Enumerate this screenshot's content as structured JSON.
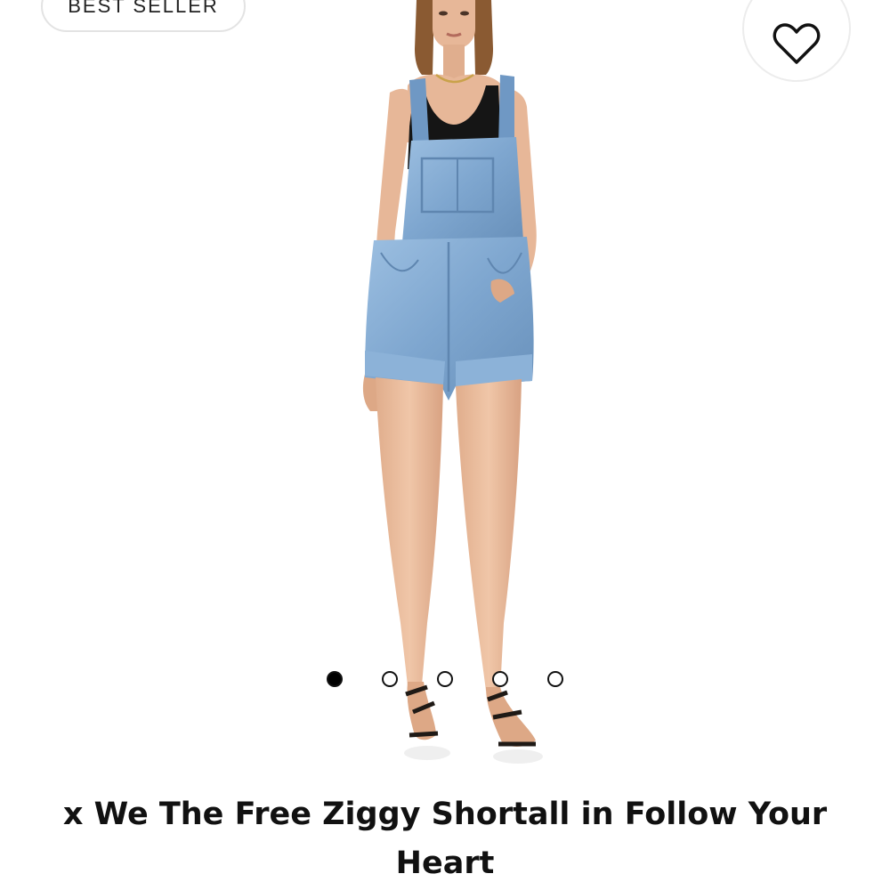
{
  "badge": {
    "label": "BEST SELLER"
  },
  "favorite": {
    "icon": "heart-outline-icon"
  },
  "gallery": {
    "slides": [
      "slide-1",
      "slide-2",
      "slide-3",
      "slide-4",
      "slide-5"
    ],
    "active_index": 0
  },
  "product": {
    "title": "x We The Free Ziggy Shortall in Follow Your Heart"
  },
  "colors": {
    "text": "#111111",
    "denim": "#7ea6cf",
    "top": "#151515",
    "skin": "#e7b798"
  }
}
